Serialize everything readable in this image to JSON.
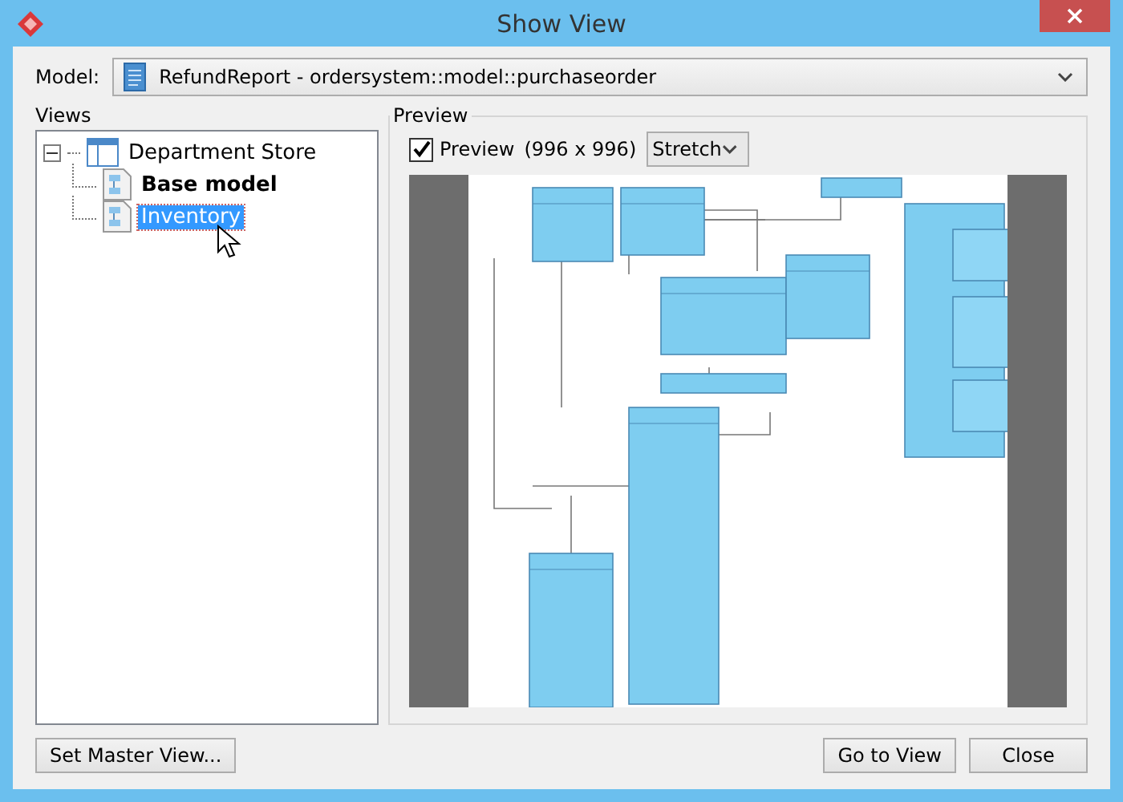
{
  "window": {
    "title": "Show View"
  },
  "model": {
    "label": "Model:",
    "value": "RefundReport - ordersystem::model::purchaseorder"
  },
  "views": {
    "title": "Views",
    "tree": [
      {
        "label": "Department Store",
        "expanded": true,
        "selected": false,
        "bold": false,
        "children": [
          {
            "label": "Base model",
            "selected": false,
            "bold": true
          },
          {
            "label": "Inventory",
            "selected": true,
            "bold": false
          }
        ]
      }
    ]
  },
  "preview": {
    "title": "Preview",
    "checkbox": {
      "label": "Preview",
      "checked": true
    },
    "size": "(996 x 996)",
    "scale": "Stretch"
  },
  "buttons": {
    "left": [
      "Set Master View..."
    ],
    "right": [
      "Go to View",
      "Close"
    ]
  }
}
